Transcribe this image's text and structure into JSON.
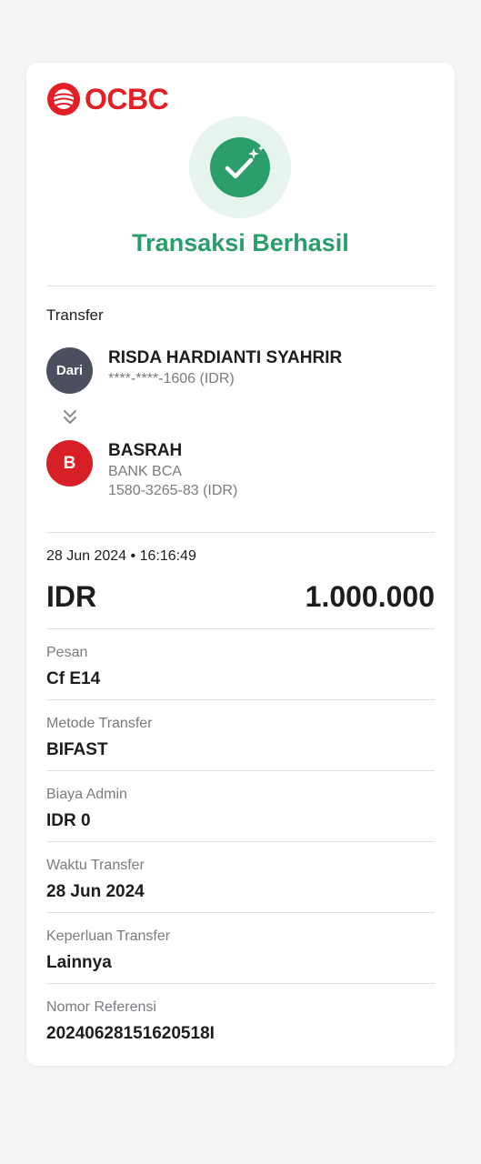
{
  "brand": {
    "name": "OCBC",
    "color": "#e31e24"
  },
  "status": {
    "title": "Transaksi Berhasil",
    "icon": "check-sparkle-icon",
    "color": "#2a9d6a"
  },
  "transfer": {
    "section_label": "Transfer",
    "from": {
      "avatar_text": "Dari",
      "name": "RISDA HARDIANTI SYAHRIR",
      "account": "****-****-1606 (IDR)"
    },
    "to": {
      "avatar_text": "B",
      "name": "BASRAH",
      "bank": "BANK BCA",
      "account": "1580-3265-83 (IDR)"
    }
  },
  "summary": {
    "datetime": "28 Jun 2024 • 16:16:49",
    "currency": "IDR",
    "amount": "1.000.000"
  },
  "details": [
    {
      "label": "Pesan",
      "value": "Cf E14"
    },
    {
      "label": "Metode Transfer",
      "value": "BIFAST"
    },
    {
      "label": "Biaya Admin",
      "value": "IDR 0"
    },
    {
      "label": "Waktu Transfer",
      "value": "28 Jun 2024"
    },
    {
      "label": "Keperluan Transfer",
      "value": "Lainnya"
    },
    {
      "label": "Nomor Referensi",
      "value": "20240628151620518I"
    }
  ]
}
